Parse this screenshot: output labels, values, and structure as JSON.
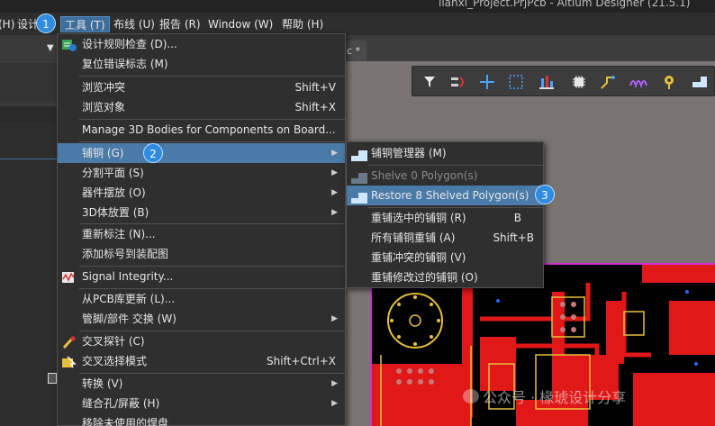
{
  "window": {
    "title": "lianxi_Project.PrjPcb - Altium Designer (21.5.1)"
  },
  "menubar": {
    "items": [
      "(H)",
      "设计",
      "工具 (T)",
      "布线 (U)",
      "报告 (R)",
      "Window (W)",
      "帮助 (H)"
    ]
  },
  "tab": {
    "label": "c *"
  },
  "tools_menu": {
    "items": [
      {
        "label": "设计规则检查 (D)...",
        "shortcut": ""
      },
      {
        "label": "复位错误标志 (M)",
        "shortcut": ""
      },
      {
        "label": "浏览冲突",
        "shortcut": "Shift+V"
      },
      {
        "label": "浏览对象",
        "shortcut": "Shift+X"
      },
      {
        "label": "Manage 3D Bodies for Components on Board...",
        "shortcut": ""
      },
      {
        "label": "铺铜 (G)",
        "shortcut": ""
      },
      {
        "label": "分割平面 (S)",
        "shortcut": ""
      },
      {
        "label": "器件摆放 (O)",
        "shortcut": ""
      },
      {
        "label": "3D体放置 (B)",
        "shortcut": ""
      },
      {
        "label": "重新标注 (N)...",
        "shortcut": ""
      },
      {
        "label": "添加标号到装配图",
        "shortcut": ""
      },
      {
        "label": "Signal Integrity...",
        "shortcut": ""
      },
      {
        "label": "从PCB库更新 (L)...",
        "shortcut": ""
      },
      {
        "label": "管脚/部件 交换 (W)",
        "shortcut": ""
      },
      {
        "label": "交叉探针 (C)",
        "shortcut": ""
      },
      {
        "label": "交叉选择模式",
        "shortcut": "Shift+Ctrl+X"
      },
      {
        "label": "转换 (V)",
        "shortcut": ""
      },
      {
        "label": "缝合孔/屏蔽 (H)",
        "shortcut": ""
      },
      {
        "label": "移除未使用的焊盘",
        "shortcut": ""
      }
    ]
  },
  "polygon_menu": {
    "items": [
      {
        "label": "铺铜管理器 (M)",
        "shortcut": ""
      },
      {
        "label": "Shelve 0 Polygon(s)",
        "shortcut": ""
      },
      {
        "label": "Restore 8 Shelved Polygon(s)",
        "shortcut": ""
      },
      {
        "label": "重铺选中的铺铜 (R)",
        "shortcut": "B"
      },
      {
        "label": "所有铺铜重铺 (A)",
        "shortcut": "Shift+B"
      },
      {
        "label": "重铺冲突的铺铜 (V)",
        "shortcut": ""
      },
      {
        "label": "重铺修改过的铺铜 (O)",
        "shortcut": ""
      }
    ]
  },
  "badges": [
    "1",
    "2",
    "3"
  ],
  "watermark": {
    "text": "公众号 · 椽琥设计分享"
  },
  "colors": {
    "accent": "#4a7aa8",
    "badge": "#2f8ce0",
    "pcb_outline": "#d030d0",
    "copper": "#e01818"
  }
}
